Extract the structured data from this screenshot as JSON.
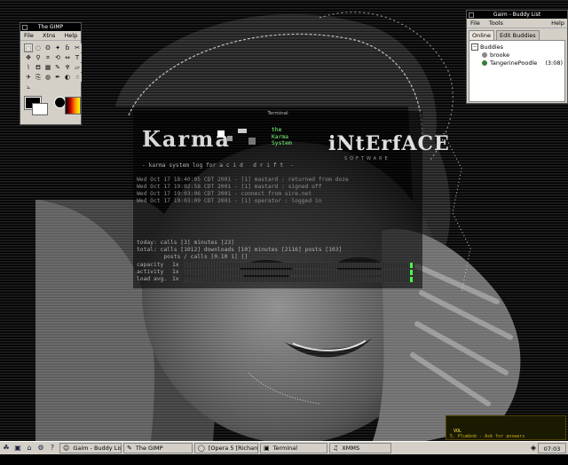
{
  "gimp": {
    "title": "The GIMP",
    "menu": [
      "File",
      "Xtns",
      "Help"
    ],
    "tools": [
      {
        "icon": "rect-select-icon",
        "glyph": "⬚"
      },
      {
        "icon": "ellipse-select-icon",
        "glyph": "◌"
      },
      {
        "icon": "lasso-icon",
        "glyph": "ʘ"
      },
      {
        "icon": "fuzzy-select-icon",
        "glyph": "✦"
      },
      {
        "icon": "bezier-select-icon",
        "glyph": "ɓ"
      },
      {
        "icon": "scissors-icon",
        "glyph": "✂"
      },
      {
        "icon": "move-icon",
        "glyph": "✥"
      },
      {
        "icon": "magnify-icon",
        "glyph": "⚲"
      },
      {
        "icon": "crop-icon",
        "glyph": "⌗"
      },
      {
        "icon": "transform-icon",
        "glyph": "⟲"
      },
      {
        "icon": "flip-icon",
        "glyph": "⇔"
      },
      {
        "icon": "text-icon",
        "glyph": "T"
      },
      {
        "icon": "color-picker-icon",
        "glyph": "⌇"
      },
      {
        "icon": "bucket-fill-icon",
        "glyph": "⛾"
      },
      {
        "icon": "blend-icon",
        "glyph": "▦"
      },
      {
        "icon": "pencil-icon",
        "glyph": "✎"
      },
      {
        "icon": "paintbrush-icon",
        "glyph": "♆"
      },
      {
        "icon": "eraser-icon",
        "glyph": "▱"
      },
      {
        "icon": "airbrush-icon",
        "glyph": "✈"
      },
      {
        "icon": "clone-icon",
        "glyph": "⎘"
      },
      {
        "icon": "convolve-icon",
        "glyph": "◍"
      },
      {
        "icon": "ink-icon",
        "glyph": "✒"
      },
      {
        "icon": "dodge-burn-icon",
        "glyph": "◐"
      },
      {
        "icon": "smudge-icon",
        "glyph": "☝"
      },
      {
        "icon": "measure-icon",
        "glyph": "⦣"
      }
    ]
  },
  "gaim": {
    "title": "Gaim - Buddy List",
    "menu": [
      "File",
      "Tools",
      "Help"
    ],
    "tabs": [
      "Online",
      "Edit Buddies"
    ],
    "group": "Buddies",
    "buddies": [
      {
        "name": "brooke",
        "idle": "",
        "color": "#888888"
      },
      {
        "name": "TangerinePoodle",
        "idle": "(3:08)",
        "color": "#3a7a3a"
      }
    ]
  },
  "terminal": {
    "title": "Terminal",
    "logo_left": "Karma",
    "logo_right": "iNtErfACE",
    "softworks": "SOFTWARE",
    "karma_system": [
      "the",
      "Karma",
      "System"
    ],
    "header_line": "- karma system log for a c i d   d r i f t  -",
    "log": [
      "Wed Oct 17 18:40:05 CDT 2001 - [1] mastard : returned from doze",
      "Wed Oct 17 19:02:58 CDT 2001 - [1] mastard : signed off",
      "Wed Oct 17 19:03:06 CDT 2001 - connect from sire.net",
      "Wed Oct 17 19:03:09 CDT 2001 - [1] operator : logged in"
    ],
    "stats": [
      "today: calls [3] minutes [23]",
      "total: calls [1012] downloads [10] minutes [2116] posts [103]",
      "        posts / calls [0.10 1] []"
    ],
    "meters": [
      {
        "label": "capacity",
        "value": "1x"
      },
      {
        "label": "activity",
        "value": "1x"
      },
      {
        "label": "load avg.",
        "value": "1x"
      }
    ]
  },
  "xmms": {
    "vol_label": "VOL",
    "song": "5. Plumbob - Ask for answers"
  },
  "taskbar": {
    "launchers": [
      {
        "icon": "gnome-foot-icon",
        "glyph": "☘"
      },
      {
        "icon": "terminal-launcher-icon",
        "glyph": "▣"
      },
      {
        "icon": "home-launcher-icon",
        "glyph": "⌂"
      },
      {
        "icon": "settings-launcher-icon",
        "glyph": "⚙"
      },
      {
        "icon": "help-launcher-icon",
        "glyph": "?"
      }
    ],
    "tasks": [
      {
        "name": "task-gaim",
        "label": "Gaim - Buddy List",
        "glyph": "☺"
      },
      {
        "name": "task-gimp",
        "label": "The GIMP",
        "glyph": "✎"
      },
      {
        "name": "task-opera",
        "label": "[Opera 5 [Richard's...]",
        "glyph": "◯"
      },
      {
        "name": "task-terminal",
        "label": "Terminal",
        "glyph": "▣"
      },
      {
        "name": "task-xmms",
        "label": "XMMS",
        "glyph": "♫"
      }
    ],
    "clock": "07:03 PM"
  }
}
